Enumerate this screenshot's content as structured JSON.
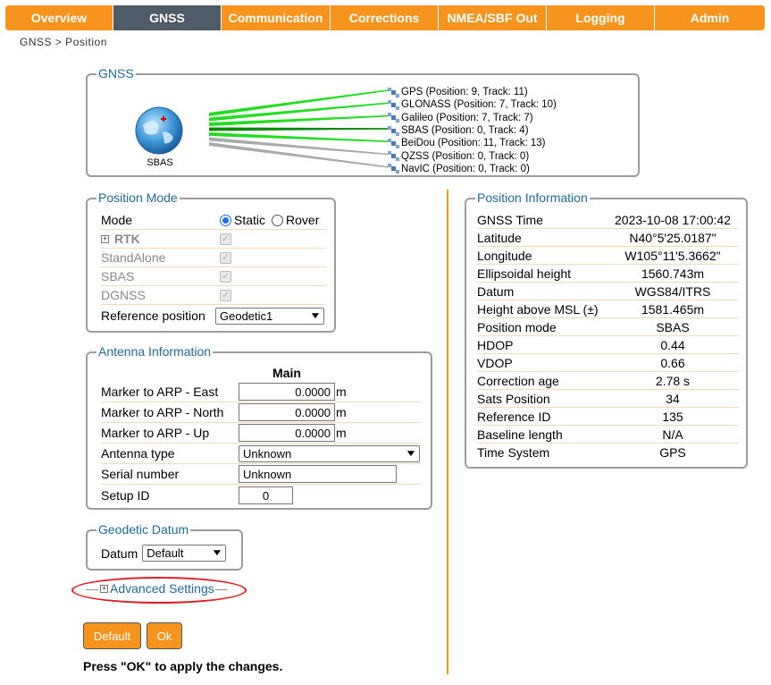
{
  "nav": {
    "tabs": [
      {
        "label": "Overview"
      },
      {
        "label": "GNSS",
        "active": true
      },
      {
        "label": "Communication"
      },
      {
        "label": "Corrections"
      },
      {
        "label": "NMEA/SBF Out"
      },
      {
        "label": "Logging"
      },
      {
        "label": "Admin"
      }
    ]
  },
  "breadcrumb": "GNSS > Position",
  "gnss": {
    "legend": "GNSS",
    "globe_label": "SBAS",
    "constellations": [
      {
        "label": "GPS (Position: 9, Track: 11)",
        "line_color": "#22dd22"
      },
      {
        "label": "GLONASS (Position: 7, Track: 10)",
        "line_color": "#22dd22"
      },
      {
        "label": "Galileo (Position: 7, Track: 7)",
        "line_color": "#22dd22"
      },
      {
        "label": "SBAS (Position: 0, Track: 4)",
        "line_color": "#0a8a0a"
      },
      {
        "label": "BeiDou (Position: 11, Track: 13)",
        "line_color": "#22dd22"
      },
      {
        "label": "QZSS (Position: 0, Track: 0)",
        "line_color": "#aaaaaa"
      },
      {
        "label": "NavIC (Position: 0, Track: 0)",
        "line_color": "#aaaaaa"
      }
    ]
  },
  "position_mode": {
    "legend": "Position Mode",
    "mode_label": "Mode",
    "static_label": "Static",
    "rover_label": "Rover",
    "selected_mode": "Static",
    "rtk_label": "RTK",
    "standalone_label": "StandAlone",
    "sbas_label": "SBAS",
    "dgnss_label": "DGNSS",
    "reference_label": "Reference position",
    "reference_value": "Geodetic1"
  },
  "antenna": {
    "legend": "Antenna Information",
    "column_header": "Main",
    "rows": [
      {
        "label": "Marker to ARP - East",
        "value": "0.0000",
        "unit": "m"
      },
      {
        "label": "Marker to ARP - North",
        "value": "0.0000",
        "unit": "m"
      },
      {
        "label": "Marker to ARP - Up",
        "value": "0.0000",
        "unit": "m"
      }
    ],
    "antenna_type_label": "Antenna type",
    "antenna_type_value": "Unknown",
    "serial_label": "Serial number",
    "serial_value": "Unknown",
    "setup_id_label": "Setup ID",
    "setup_id_value": "0"
  },
  "datum": {
    "legend": "Geodetic Datum",
    "label": "Datum",
    "value": "Default"
  },
  "advanced_settings": "Advanced Settings",
  "buttons": {
    "default": "Default",
    "ok": "Ok"
  },
  "note": "Press \"OK\" to apply the changes.",
  "position_info": {
    "legend": "Position Information",
    "rows": [
      {
        "label": "GNSS Time",
        "value": "2023-10-08 17:00:42"
      },
      {
        "label": "Latitude",
        "value": "N40°5'25.0187\""
      },
      {
        "label": "Longitude",
        "value": "W105°11'5.3662\""
      },
      {
        "label": "Ellipsoidal height",
        "value": "1560.743m"
      },
      {
        "label": "Datum",
        "value": "WGS84/ITRS"
      },
      {
        "label": "Height above MSL (±)",
        "value": "1581.465m"
      },
      {
        "label": "Position mode",
        "value": "SBAS"
      },
      {
        "label": "HDOP",
        "value": "0.44"
      },
      {
        "label": "VDOP",
        "value": "0.66"
      },
      {
        "label": "Correction age",
        "value": "2.78 s"
      },
      {
        "label": "Sats Position",
        "value": "34"
      },
      {
        "label": "Reference ID",
        "value": "135"
      },
      {
        "label": "Baseline length",
        "value": "N/A"
      },
      {
        "label": "Time System",
        "value": "GPS"
      }
    ]
  },
  "colors": {
    "accent": "#f7941d",
    "active_tab": "#4f5b66",
    "legend": "#1a6ca1",
    "highlight": "#e11d23"
  }
}
